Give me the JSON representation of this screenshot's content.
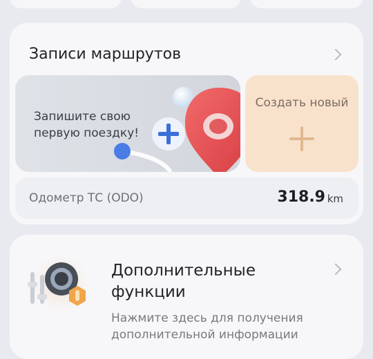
{
  "routes_card": {
    "title": "Записи маршрутов",
    "first_trip_text": "Запишите свою\nпервую поездку!",
    "create_label": "Создать новый"
  },
  "odometer": {
    "label": "Одометр ТС (ODO)",
    "value": "318.9",
    "unit": "km"
  },
  "extra_card": {
    "title": "Дополнительные\nфункции",
    "subtitle": "Нажмите здесь для получения\nдополнительной информации"
  },
  "colors": {
    "background": "#e9eaf0",
    "card": "#f7f7fa",
    "create_tile": "#f9e2cc",
    "pin_red": "#e8474b",
    "accent_blue": "#3a6fd8"
  }
}
